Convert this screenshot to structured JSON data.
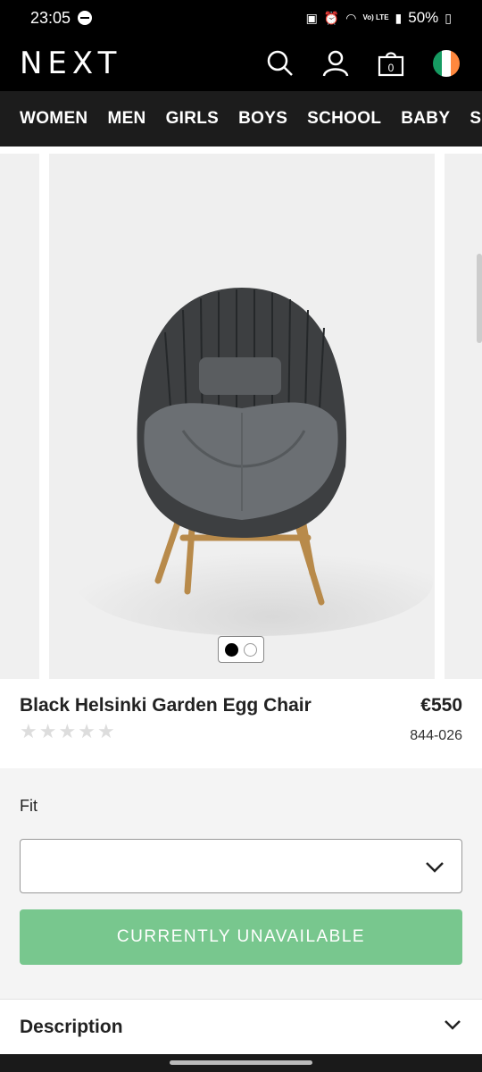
{
  "status_bar": {
    "time": "23:05",
    "network": "Vo) LTE",
    "battery": "50%"
  },
  "header": {
    "logo": "NEXT",
    "bag_count": "0",
    "icons": [
      "search-icon",
      "account-icon",
      "bag-icon",
      "ireland-flag-icon"
    ]
  },
  "nav": {
    "items": [
      "WOMEN",
      "MEN",
      "GIRLS",
      "BOYS",
      "SCHOOL",
      "BABY",
      "SH"
    ]
  },
  "carousel": {
    "total_images": 2,
    "active_index": 0
  },
  "product": {
    "title": "Black Helsinki Garden Egg Chair",
    "price": "€550",
    "code": "844-026",
    "rating_stars": 0,
    "rating_max": 5
  },
  "fit": {
    "label": "Fit",
    "selected_value": ""
  },
  "cta": {
    "label": "CURRENTLY UNAVAILABLE",
    "color": "#78c78e"
  },
  "description": {
    "label": "Description"
  }
}
